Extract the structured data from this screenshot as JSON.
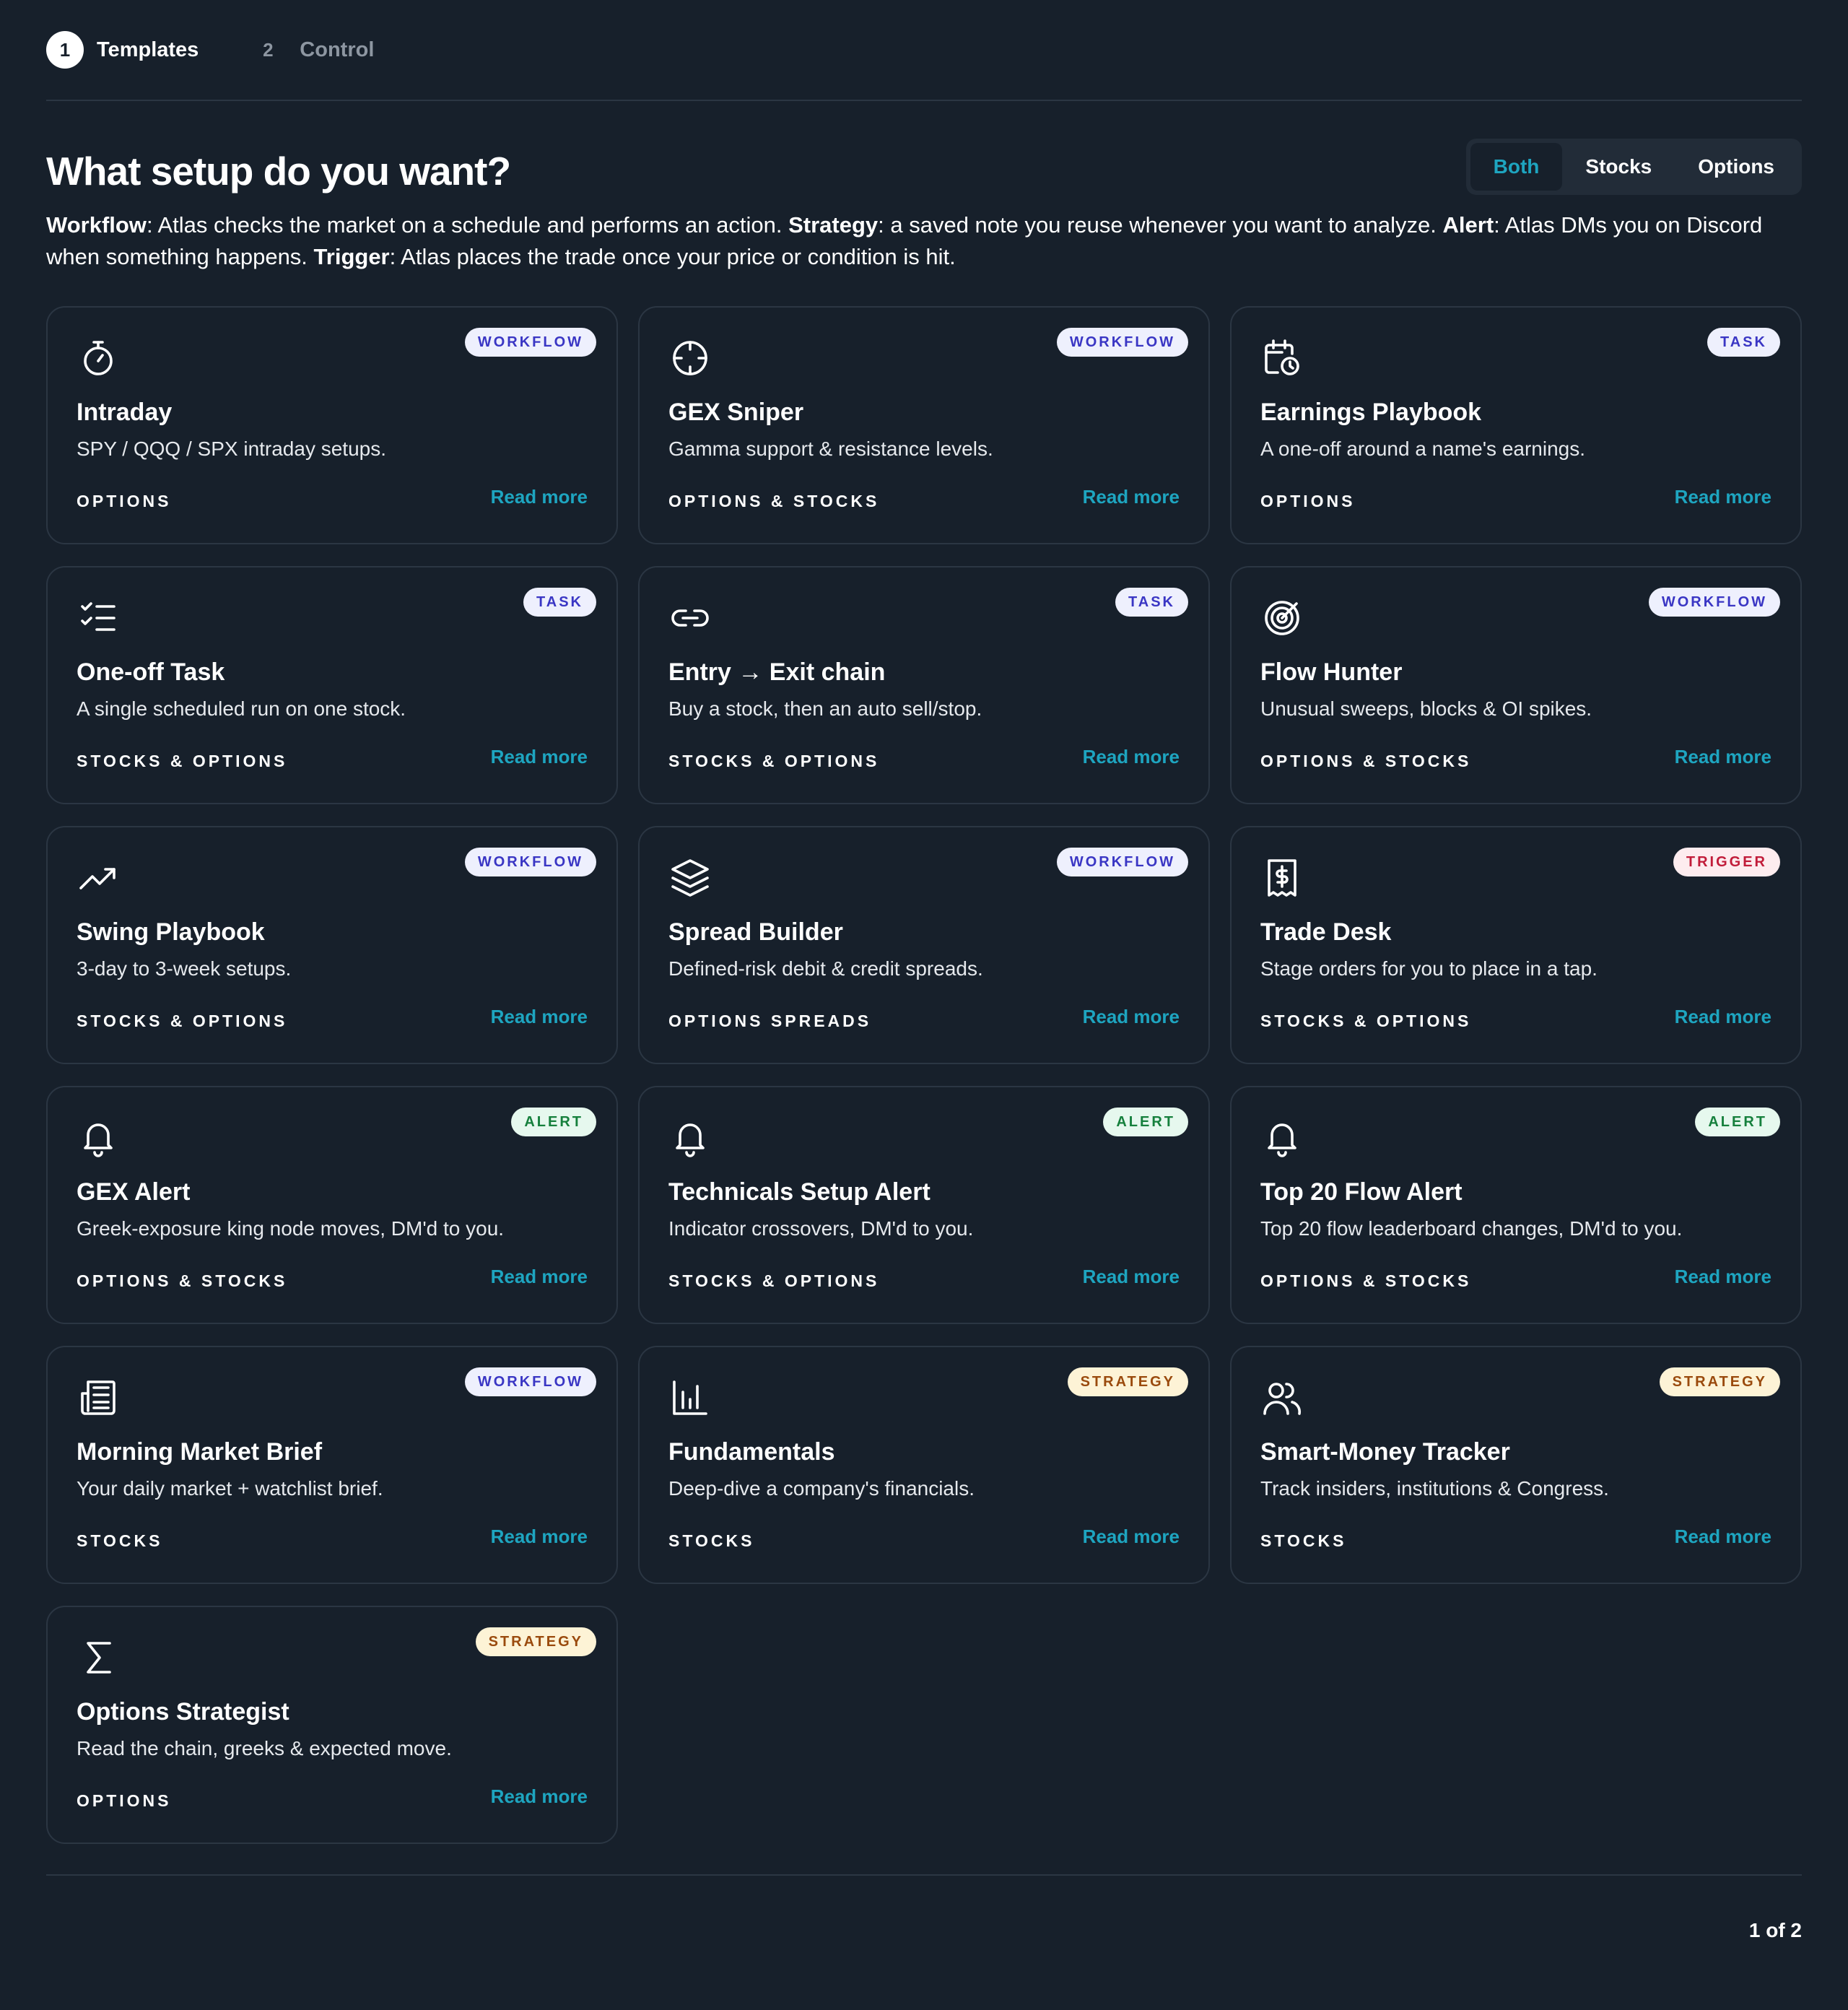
{
  "stepper": {
    "steps": [
      {
        "num": "1",
        "label": "Templates"
      },
      {
        "num": "2",
        "label": "Control"
      }
    ]
  },
  "header": {
    "title": "What setup do you want?",
    "filters": [
      "Both",
      "Stocks",
      "Options"
    ],
    "active_filter": "Both"
  },
  "description": {
    "workflow_term": "Workflow",
    "workflow_text": ": Atlas checks the market on a schedule and performs an action. ",
    "strategy_term": "Strategy",
    "strategy_text": ": a saved note you reuse whenever you want to analyze. ",
    "alert_term": "Alert",
    "alert_text": ": Atlas DMs you on Discord when something happens. ",
    "trigger_term": "Trigger",
    "trigger_text": ": Atlas places the trade once your price or condition is hit."
  },
  "read_more_label": "Read more",
  "cards": [
    {
      "icon": "stopwatch-icon",
      "badge": "WORKFLOW",
      "title": "Intraday",
      "desc": "SPY / QQQ / SPX intraday setups.",
      "market": "OPTIONS",
      "read": "Read more"
    },
    {
      "icon": "crosshair-icon",
      "badge": "WORKFLOW",
      "title": "GEX Sniper",
      "desc": "Gamma support & resistance levels.",
      "market": "OPTIONS & STOCKS",
      "read": "Read more"
    },
    {
      "icon": "calendar-clock-icon",
      "badge": "TASK",
      "title": "Earnings Playbook",
      "desc": "A one-off around a name's earnings.",
      "market": "OPTIONS",
      "read": "Read more"
    },
    {
      "icon": "checklist-icon",
      "badge": "TASK",
      "title": "One-off Task",
      "desc": "A single scheduled run on one stock.",
      "market": "STOCKS & OPTIONS",
      "read": "Read more"
    },
    {
      "icon": "link-icon",
      "badge": "TASK",
      "title": "Entry → Exit chain",
      "desc": "Buy a stock, then an auto sell/stop.",
      "market": "STOCKS & OPTIONS",
      "read": "Read more"
    },
    {
      "icon": "radar-icon",
      "badge": "WORKFLOW",
      "title": "Flow Hunter",
      "desc": "Unusual sweeps, blocks & OI spikes.",
      "market": "OPTIONS & STOCKS",
      "read": "Read more"
    },
    {
      "icon": "trending-up-icon",
      "badge": "WORKFLOW",
      "title": "Swing Playbook",
      "desc": "3-day to 3-week setups.",
      "market": "STOCKS & OPTIONS",
      "read": "Read more"
    },
    {
      "icon": "layers-icon",
      "badge": "WORKFLOW",
      "title": "Spread Builder",
      "desc": "Defined-risk debit & credit spreads.",
      "market": "OPTIONS SPREADS",
      "read": "Read more"
    },
    {
      "icon": "receipt-dollar-icon",
      "badge": "TRIGGER",
      "title": "Trade Desk",
      "desc": "Stage orders for you to place in a tap.",
      "market": "STOCKS & OPTIONS",
      "read": "Read more"
    },
    {
      "icon": "bell-icon",
      "badge": "ALERT",
      "title": "GEX Alert",
      "desc": "Greek-exposure king node moves, DM'd to you.",
      "market": "OPTIONS & STOCKS",
      "read": "Read more"
    },
    {
      "icon": "bell-icon",
      "badge": "ALERT",
      "title": "Technicals Setup Alert",
      "desc": "Indicator crossovers, DM'd to you.",
      "market": "STOCKS & OPTIONS",
      "read": "Read more"
    },
    {
      "icon": "bell-icon",
      "badge": "ALERT",
      "title": "Top 20 Flow Alert",
      "desc": "Top 20 flow leaderboard changes, DM'd to you.",
      "market": "OPTIONS & STOCKS",
      "read": "Read more"
    },
    {
      "icon": "newspaper-icon",
      "badge": "WORKFLOW",
      "title": "Morning Market Brief",
      "desc": "Your daily market + watchlist brief.",
      "market": "STOCKS",
      "read": "Read more"
    },
    {
      "icon": "bar-chart-icon",
      "badge": "STRATEGY",
      "title": "Fundamentals",
      "desc": "Deep-dive a company's financials.",
      "market": "STOCKS",
      "read": "Read more"
    },
    {
      "icon": "users-icon",
      "badge": "STRATEGY",
      "title": "Smart-Money Tracker",
      "desc": "Track insiders, institutions & Congress.",
      "market": "STOCKS",
      "read": "Read more"
    },
    {
      "icon": "sigma-icon",
      "badge": "STRATEGY",
      "title": "Options Strategist",
      "desc": "Read the chain, greeks & expected move.",
      "market": "OPTIONS",
      "read": "Read more"
    }
  ],
  "pager": "1 of 2",
  "colors": {
    "background": "#17202b",
    "accent": "#1ea5c0",
    "border": "#2b3643"
  }
}
